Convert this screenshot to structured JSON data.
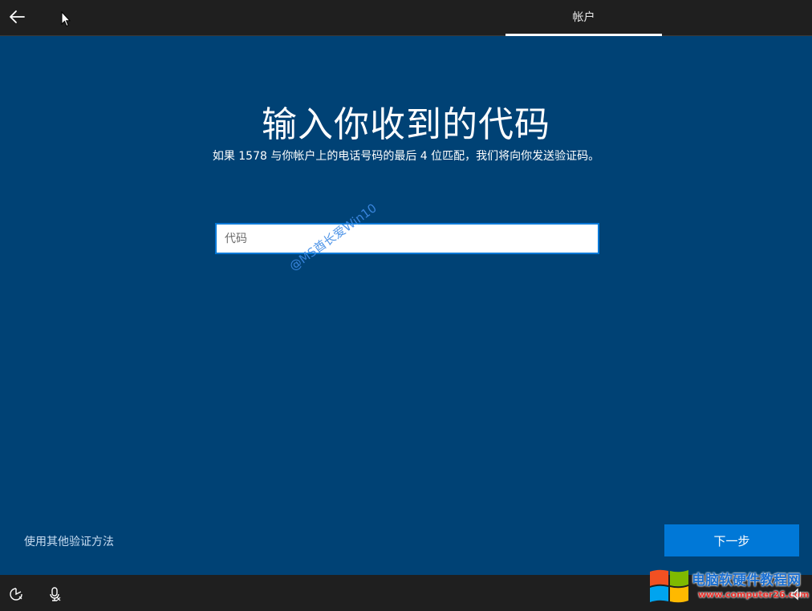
{
  "header": {
    "tab_label": "帐户"
  },
  "main": {
    "title": "输入你收到的代码",
    "subtitle": "如果 1578 与你帐户上的电话号码的最后 4 位匹配，我们将向你发送验证码。",
    "code_input": {
      "placeholder": "代码",
      "value": ""
    },
    "watermark": "@MS酋长爱Win10",
    "alt_method_link": "使用其他验证方法",
    "next_button": "下一步"
  },
  "bottom_bar": {
    "icons": [
      "accessibility-icon",
      "microphone-icon",
      "volume-icon"
    ]
  },
  "site_logo": {
    "name": "电脑软硬件教程网",
    "url": "www.computer26.com"
  },
  "colors": {
    "main_bg": "#004275",
    "bar_bg": "#1f1f1f",
    "accent": "#0078d7"
  }
}
